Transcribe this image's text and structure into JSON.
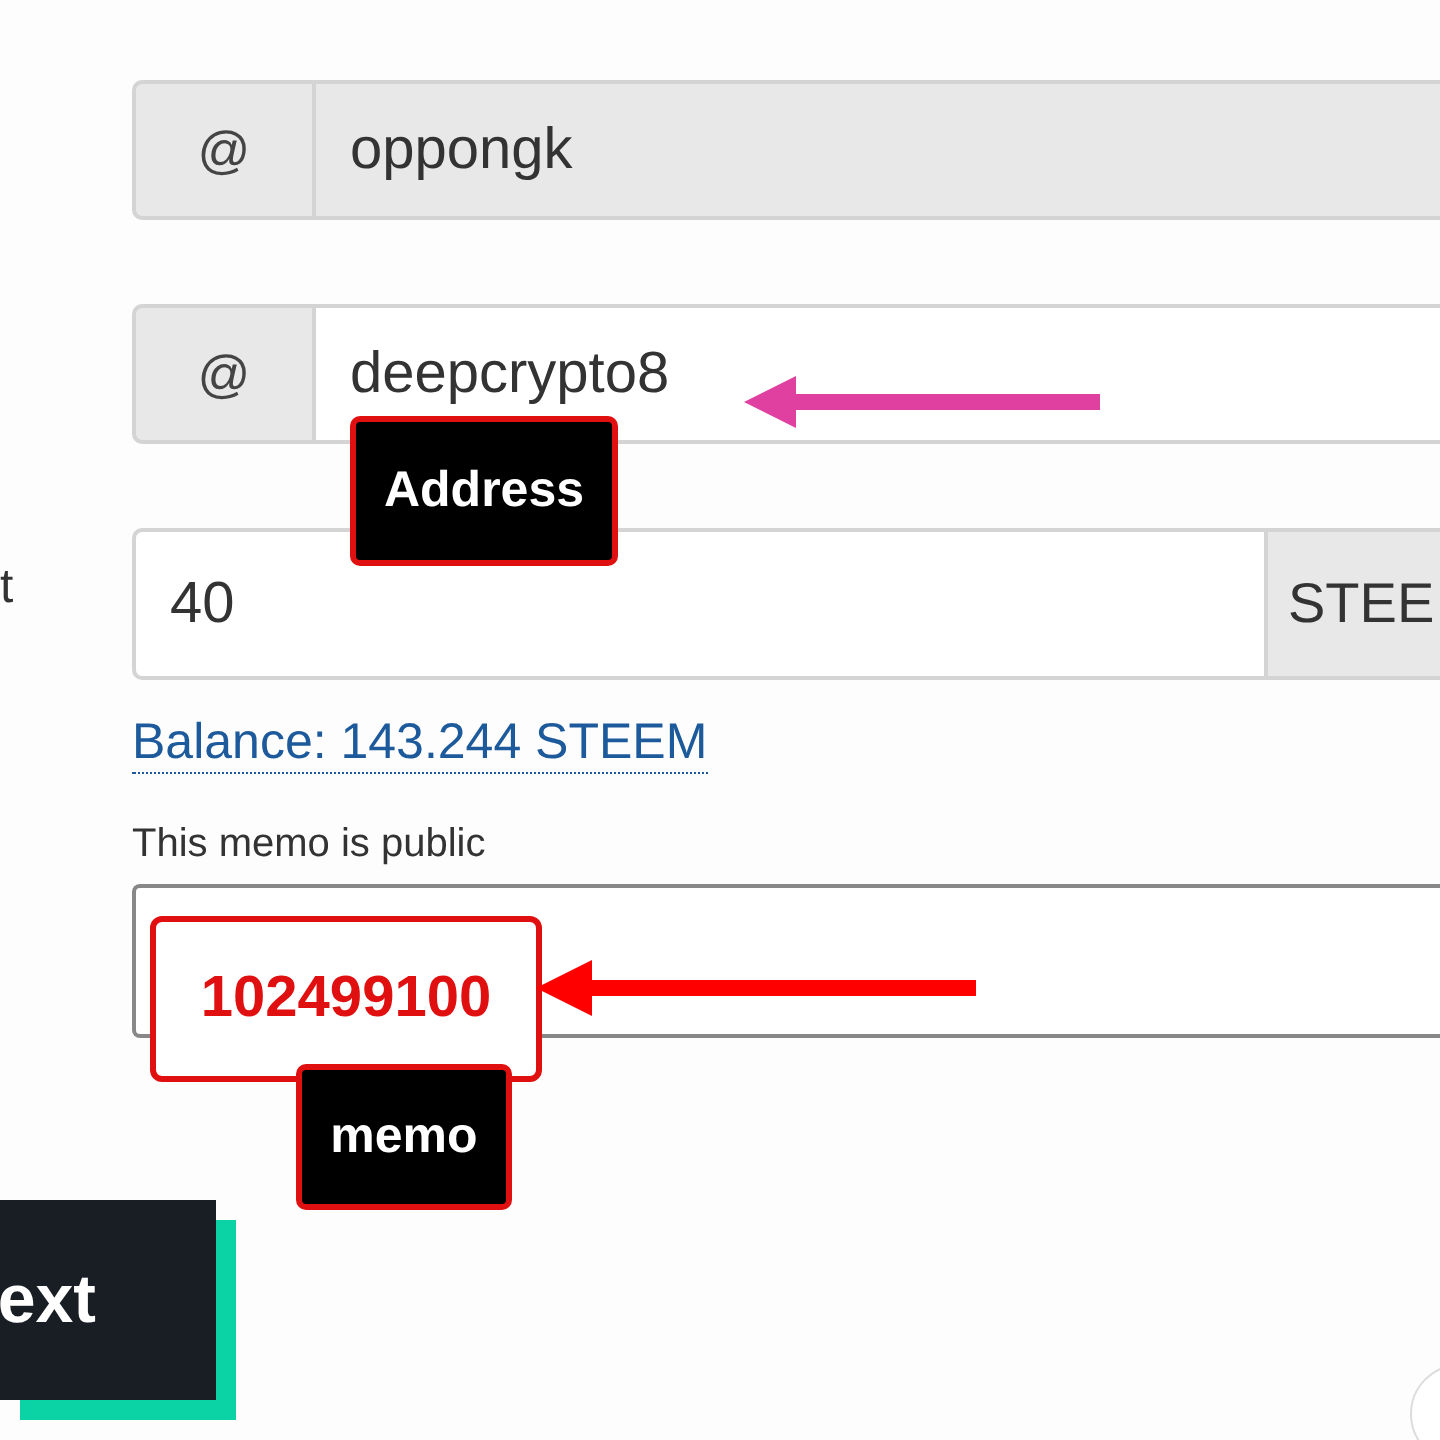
{
  "amount_label": "t",
  "from": {
    "prefix": "@",
    "value": "oppongk",
    "disabled": true
  },
  "to": {
    "prefix": "@",
    "value": "deepcrypto8",
    "disabled": false
  },
  "amount": {
    "value": "40",
    "currency": "STEE"
  },
  "balance": "Balance: 143.244 STEEM",
  "memo": {
    "label": "This memo is public"
  },
  "annotations": [
    {
      "kind": "arrow",
      "color": "#e040a0"
    },
    {
      "kind": "label",
      "text": "Address"
    },
    {
      "kind": "highlight",
      "text": "102499100"
    },
    {
      "kind": "arrow",
      "color": "#ff0000"
    },
    {
      "kind": "label",
      "text": "memo"
    }
  ],
  "next_button": "ext"
}
